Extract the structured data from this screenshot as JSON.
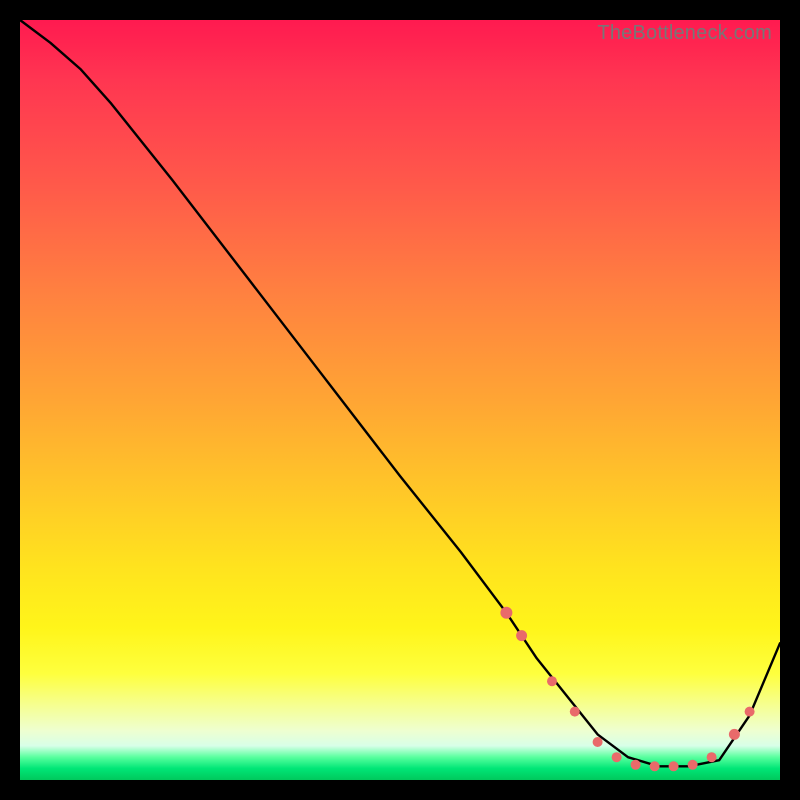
{
  "watermark": "TheBottleneck.com",
  "chart_data": {
    "type": "line",
    "title": "",
    "xlabel": "",
    "ylabel": "",
    "xlim": [
      0,
      100
    ],
    "ylim": [
      0,
      100
    ],
    "series": [
      {
        "name": "bottleneck-curve",
        "x": [
          0,
          4,
          8,
          12,
          20,
          30,
          40,
          50,
          58,
          64,
          68,
          72,
          76,
          80,
          84,
          88,
          92,
          96,
          100
        ],
        "y": [
          100,
          97,
          93.5,
          89,
          79,
          66,
          53,
          40,
          30,
          22,
          16,
          11,
          6,
          3,
          1.8,
          1.8,
          2.6,
          8.5,
          18
        ]
      }
    ],
    "markers": {
      "name": "highlighted-points",
      "color": "#e96a6a",
      "points": [
        {
          "x": 64,
          "y": 22,
          "r": 6
        },
        {
          "x": 66,
          "y": 19,
          "r": 5.5
        },
        {
          "x": 70,
          "y": 13,
          "r": 5
        },
        {
          "x": 73,
          "y": 9,
          "r": 5
        },
        {
          "x": 76,
          "y": 5,
          "r": 5
        },
        {
          "x": 78.5,
          "y": 3,
          "r": 5
        },
        {
          "x": 81,
          "y": 2,
          "r": 5
        },
        {
          "x": 83.5,
          "y": 1.8,
          "r": 5
        },
        {
          "x": 86,
          "y": 1.8,
          "r": 5
        },
        {
          "x": 88.5,
          "y": 2.0,
          "r": 5
        },
        {
          "x": 91,
          "y": 3,
          "r": 5
        },
        {
          "x": 94,
          "y": 6,
          "r": 5.5
        },
        {
          "x": 96,
          "y": 9,
          "r": 5
        }
      ]
    },
    "gradient_stops": [
      {
        "pos": 0,
        "color": "#ff1a50"
      },
      {
        "pos": 0.5,
        "color": "#ffa534"
      },
      {
        "pos": 0.8,
        "color": "#fff51a"
      },
      {
        "pos": 0.97,
        "color": "#58ff9e"
      },
      {
        "pos": 1.0,
        "color": "#00c85c"
      }
    ]
  }
}
